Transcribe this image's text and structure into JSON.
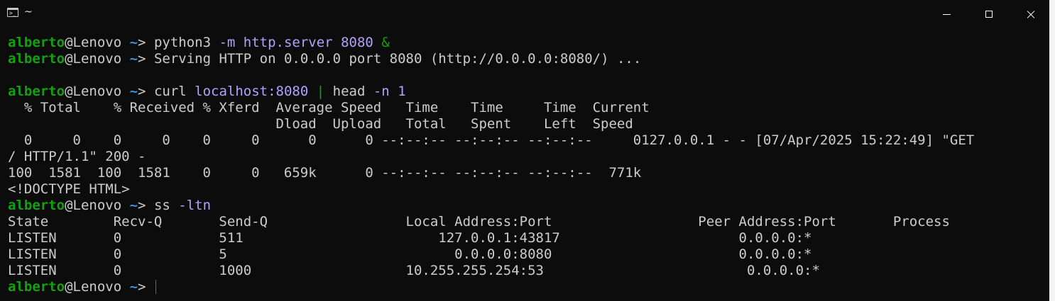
{
  "window": {
    "title": "~",
    "app_icon": "terminal-icon",
    "controls": [
      "minimize-icon",
      "maximize-icon",
      "close-icon"
    ]
  },
  "colors": {
    "background": "#0c0c0c",
    "user": "#13a10e",
    "tilde": "#3a96dd",
    "argument": "#b4a0ff",
    "text": "#cccccc"
  },
  "prompt": {
    "user": "alberto",
    "at_host": "@Lenovo",
    "dir": " ~",
    "symbol": "> "
  },
  "lines": [
    {
      "type": "cmd",
      "parts": [
        {
          "t": "python3 "
        },
        {
          "t": "-m",
          "c": "flag"
        },
        {
          "t": " "
        },
        {
          "t": "http.server",
          "c": "arg"
        },
        {
          "t": " "
        },
        {
          "t": "8080",
          "c": "arg"
        },
        {
          "t": " "
        },
        {
          "t": "&",
          "c": "op"
        }
      ]
    },
    {
      "type": "cmd",
      "parts": [
        {
          "t": "Serving HTTP on 0.0.0.0 port 8080 (http://0.0.0.0:8080/) ..."
        }
      ]
    },
    {
      "type": "out",
      "text": ""
    },
    {
      "type": "cmd",
      "parts": [
        {
          "t": "curl "
        },
        {
          "t": "localhost:8080",
          "c": "arg"
        },
        {
          "t": " "
        },
        {
          "t": "|",
          "c": "op"
        },
        {
          "t": " head "
        },
        {
          "t": "-n",
          "c": "flag"
        },
        {
          "t": " "
        },
        {
          "t": "1",
          "c": "arg"
        }
      ]
    },
    {
      "type": "out",
      "text": "  % Total    % Received % Xferd  Average Speed   Time    Time     Time  Current"
    },
    {
      "type": "out",
      "text": "                                 Dload  Upload   Total   Spent    Left  Speed"
    },
    {
      "type": "out",
      "text": "  0     0    0     0    0     0      0      0 --:--:-- --:--:-- --:--:--     0127.0.0.1 - - [07/Apr/2025 15:22:49] \"GET"
    },
    {
      "type": "out",
      "text": "/ HTTP/1.1\" 200 -"
    },
    {
      "type": "out",
      "text": "100  1581  100  1581    0     0   659k      0 --:--:-- --:--:-- --:--:--  771k"
    },
    {
      "type": "out",
      "text": "<!DOCTYPE HTML>"
    },
    {
      "type": "cmd",
      "parts": [
        {
          "t": "ss "
        },
        {
          "t": "-ltn",
          "c": "flag"
        }
      ]
    },
    {
      "type": "out",
      "text": "State        Recv-Q       Send-Q                 Local Address:Port                  Peer Address:Port       Process"
    },
    {
      "type": "out",
      "text": "LISTEN       0            511                        127.0.0.1:43817                      0.0.0.0:*"
    },
    {
      "type": "out",
      "text": "LISTEN       0            5                            0.0.0.0:8080                       0.0.0.0:*"
    },
    {
      "type": "out",
      "text": "LISTEN       0            1000                   10.255.255.254:53                         0.0.0.0:*"
    },
    {
      "type": "cmd",
      "parts": [],
      "cursor": true
    }
  ]
}
